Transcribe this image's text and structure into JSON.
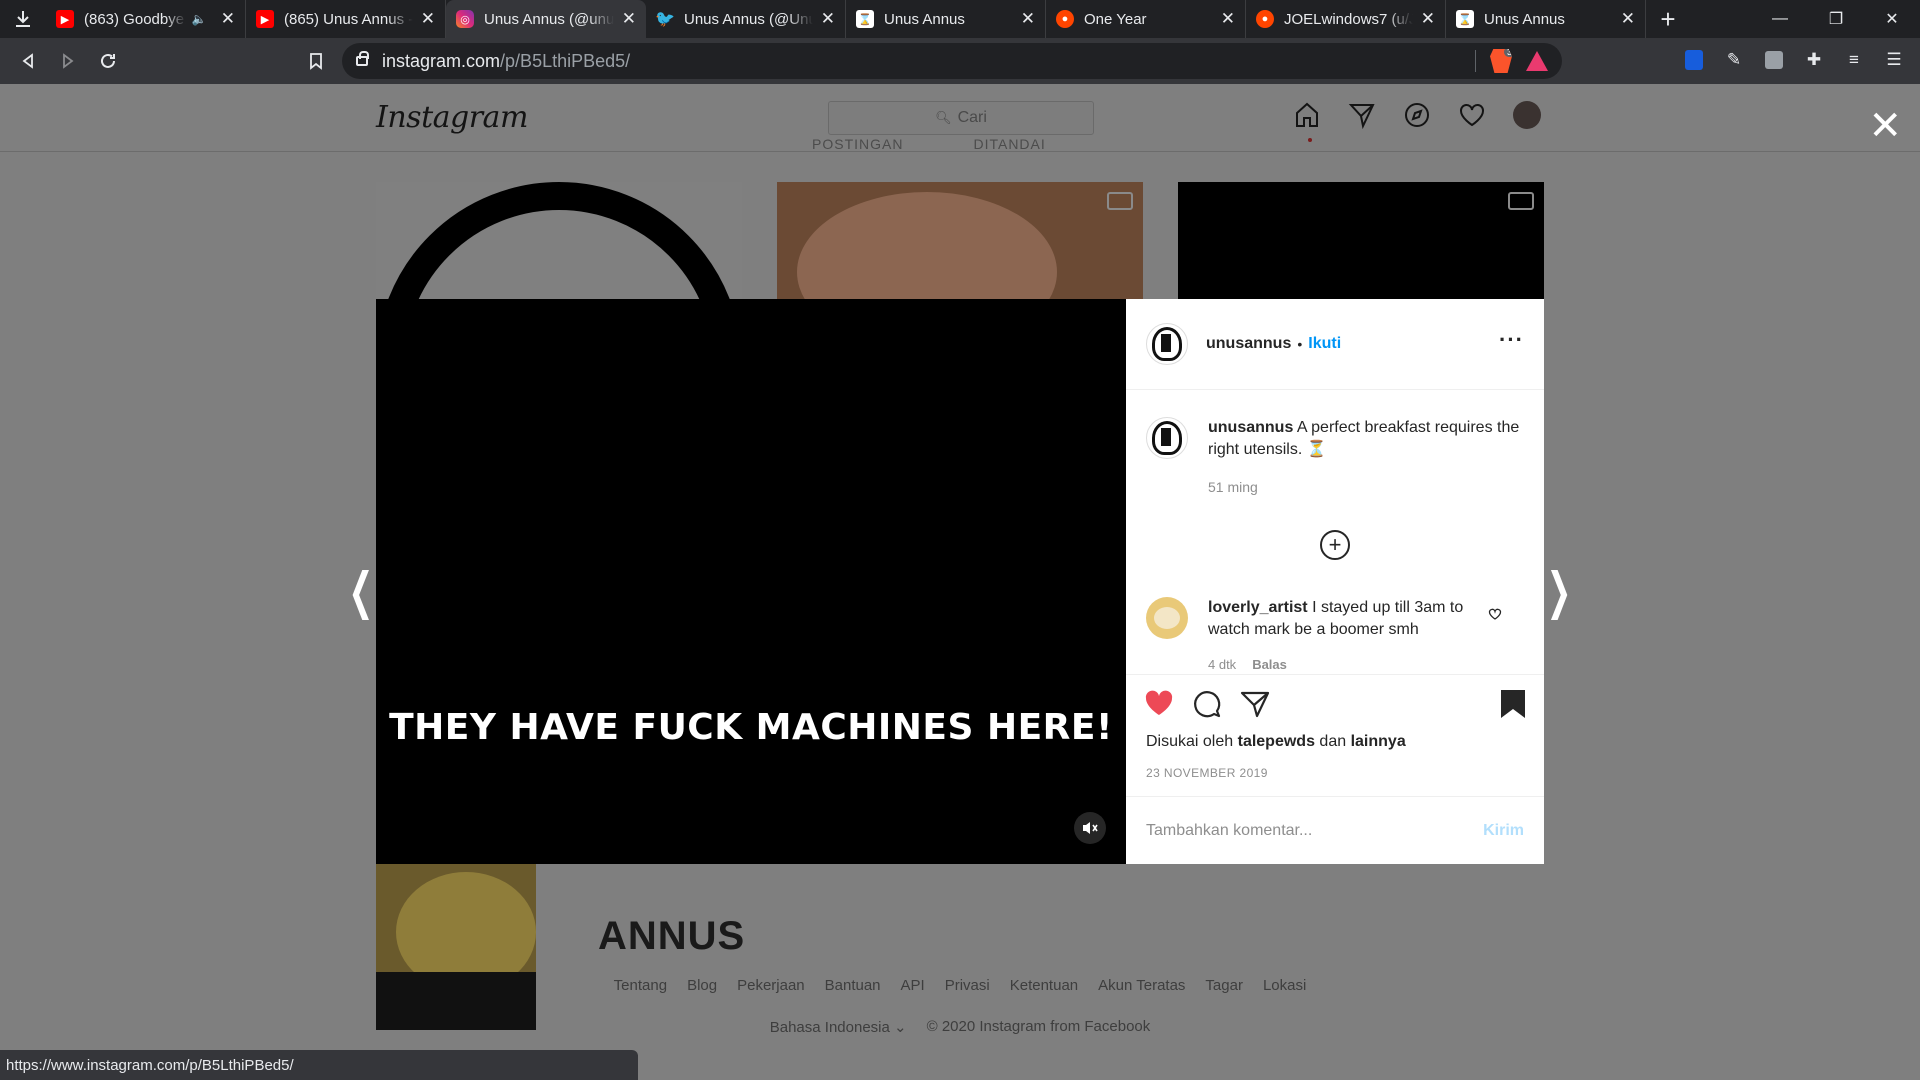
{
  "browser": {
    "tabs": [
      {
        "title": "(863) Goodbye.",
        "favicon": "youtube-icon",
        "color": "#ff0000",
        "audio": true
      },
      {
        "title": "(865) Unus Annus - ",
        "favicon": "youtube-icon",
        "color": "#ff0000"
      },
      {
        "title": "Unus Annus (@unus",
        "favicon": "instagram-icon",
        "color": "#c13584",
        "active": true
      },
      {
        "title": "Unus Annus (@Unu",
        "favicon": "twitter-icon",
        "color": "#1da1f2"
      },
      {
        "title": "Unus Annus",
        "favicon": "unusannus-icon",
        "color": "#ffffff"
      },
      {
        "title": "One Year",
        "favicon": "reddit-icon",
        "color": "#ff4500"
      },
      {
        "title": "JOELwindows7 (u/J",
        "favicon": "reddit-icon",
        "color": "#ff4500"
      },
      {
        "title": "Unus Annus",
        "favicon": "unusannus-icon",
        "color": "#ffffff"
      }
    ],
    "url_host": "instagram.com",
    "url_path": "/p/B5LthiPBed5/",
    "shields_count": "3",
    "status_url": "https://www.instagram.com/p/B5LthiPBed5/"
  },
  "instagram": {
    "logo": "Instagram",
    "search_placeholder": "Cari",
    "profile_tabs": [
      "POSTINGAN",
      "DITANDAI"
    ],
    "grid_text": "ANNUS",
    "footer_links": [
      "Tentang",
      "Blog",
      "Pekerjaan",
      "Bantuan",
      "API",
      "Privasi",
      "Ketentuan",
      "Akun Teratas",
      "Tagar",
      "Lokasi"
    ],
    "language": "Bahasa Indonesia",
    "copyright": "© 2020 Instagram from Facebook"
  },
  "post": {
    "username": "unusannus",
    "follow_label": "Ikuti",
    "video_subtitle": "THEY HAVE FUCK MACHINES HERE!",
    "caption_user": "unusannus",
    "caption_text": "A perfect breakfast requires the right utensils. ⏳",
    "caption_time": "51 ming",
    "comment": {
      "user": "loverly_artist",
      "text": "I stayed up till 3am to watch mark be a boomer smh",
      "time": "4 dtk",
      "reply_label": "Balas"
    },
    "liked_by_prefix": "Disukai oleh",
    "liked_by_user": "talepewds",
    "liked_by_mid": "dan",
    "liked_by_others": "lainnya",
    "date": "23 NOVEMBER 2019",
    "comment_placeholder": "Tambahkan komentar...",
    "send_label": "Kirim",
    "like_color": "#ed4956"
  }
}
